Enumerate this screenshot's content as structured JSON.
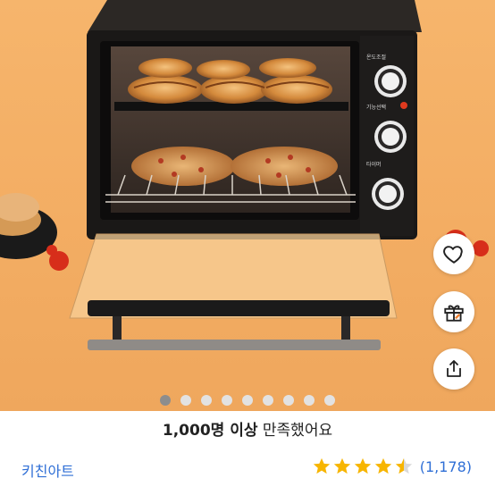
{
  "product_image": {
    "label": "toaster oven with croissants and pastries",
    "knob_labels": [
      "온도조절",
      "기능선택",
      "타이머"
    ]
  },
  "actions": {
    "like_icon": "heart-icon",
    "gift_icon": "gift-icon",
    "share_icon": "share-icon"
  },
  "carousel": {
    "total": 9,
    "active_index": 0
  },
  "satisfaction": {
    "bold": "1,000명 이상",
    "rest": " 만족했어요"
  },
  "product": {
    "brand": "키친아트"
  },
  "rating": {
    "stars": 4.5,
    "count": "(1,178)",
    "star_color": "#f7b500"
  },
  "colors": {
    "link": "#2f6fd6",
    "background": "#f3ad63"
  }
}
